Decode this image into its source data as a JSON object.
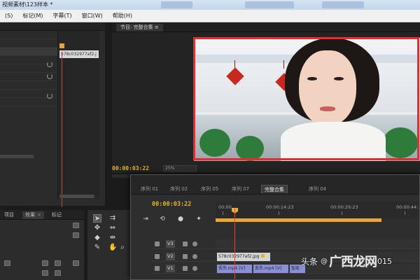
{
  "window": {
    "title": "视频素材\\123样本 *"
  },
  "menu": [
    "(S)",
    "标记(M)",
    "字幕(T)",
    "窗口(W)",
    "帮助(H)"
  ],
  "effect_controls": {
    "clip_tag": "578c032977af2.j"
  },
  "program_monitor": {
    "tab_label": "节目: 完整合集 ≡",
    "timecode": "00:00:03:22",
    "zoom": "25%",
    "highlight_color": "#e62e2e"
  },
  "project_bin": {
    "tabs": [
      {
        "label": "项目"
      },
      {
        "label": "效果",
        "active": true
      },
      {
        "label": "标记"
      }
    ]
  },
  "tools": [
    {
      "name": "selection-tool",
      "glyph": "➤",
      "active": true
    },
    {
      "name": "track-select-tool",
      "glyph": "⇉"
    },
    {
      "name": "ripple-edit-tool",
      "glyph": "✥"
    },
    {
      "name": "rolling-edit-tool",
      "glyph": "⇔"
    },
    {
      "name": "razor-tool",
      "glyph": "◆"
    },
    {
      "name": "slip-tool",
      "glyph": "⇹"
    },
    {
      "name": "pen-tool",
      "glyph": "✎"
    },
    {
      "name": "hand-tool",
      "glyph": "✋"
    },
    {
      "name": "zoom-tool",
      "glyph": "⌕"
    }
  ],
  "timeline": {
    "tabs": [
      {
        "label": "序列 01"
      },
      {
        "label": "序列 02"
      },
      {
        "label": "序列 05"
      },
      {
        "label": "序列 07"
      },
      {
        "label": "完整合集",
        "active": true
      },
      {
        "label": "序列 04"
      }
    ],
    "timecode": "00:00:03:22",
    "ruler": [
      "00:00",
      "00:00:14:23",
      "00:00:29:23",
      "00:00:44:"
    ],
    "tracks": [
      {
        "id": "V3",
        "clips": []
      },
      {
        "id": "V2",
        "clips": [
          {
            "label": "578c032977af2.jpg",
            "kind": "img"
          }
        ]
      },
      {
        "id": "V1",
        "clips": [
          {
            "label": "丢失.mp4 [V]",
            "kind": "vid"
          },
          {
            "label": "丢失.mp4 [V]",
            "kind": "vid"
          },
          {
            "label": "智能",
            "kind": "vid"
          }
        ]
      }
    ]
  },
  "watermark": {
    "text": "头条",
    "at": "@",
    "logo": "广西龙网",
    "year": "2015"
  },
  "colors": {
    "accent": "#e3b231",
    "workbar": "#e8a63b",
    "playhead": "#d84a30"
  }
}
